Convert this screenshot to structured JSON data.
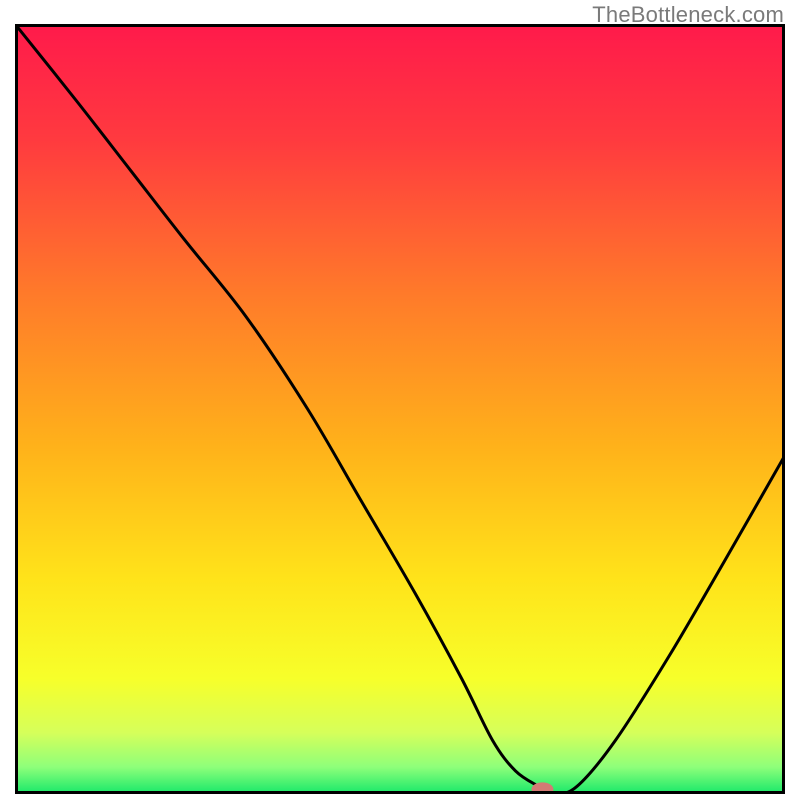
{
  "watermark": "TheBottleneck.com",
  "chart_data": {
    "type": "line",
    "title": "",
    "xlabel": "",
    "ylabel": "",
    "xlim": [
      0,
      100
    ],
    "ylim": [
      0,
      100
    ],
    "grid": false,
    "legend": false,
    "series": [
      {
        "name": "bottleneck-curve",
        "x": [
          0,
          8,
          15,
          22,
          30,
          38,
          45,
          52,
          58,
          62,
          65,
          68,
          70,
          73,
          78,
          85,
          92,
          100
        ],
        "y": [
          100,
          90,
          81,
          72,
          62,
          50,
          38,
          26,
          15,
          7,
          3,
          1,
          0,
          1,
          7,
          18,
          30,
          44
        ]
      }
    ],
    "marker": {
      "x": 68.5,
      "y": 0.6
    },
    "gradient_stops": [
      {
        "offset": 0.0,
        "color": "#ff1a4b"
      },
      {
        "offset": 0.15,
        "color": "#ff3a3f"
      },
      {
        "offset": 0.35,
        "color": "#ff7a2a"
      },
      {
        "offset": 0.55,
        "color": "#ffb21a"
      },
      {
        "offset": 0.72,
        "color": "#ffe31a"
      },
      {
        "offset": 0.85,
        "color": "#f7ff2a"
      },
      {
        "offset": 0.92,
        "color": "#d6ff5a"
      },
      {
        "offset": 0.965,
        "color": "#8eff7a"
      },
      {
        "offset": 1.0,
        "color": "#17e86a"
      }
    ],
    "curve_stroke": "#000000",
    "curve_stroke_width": 3,
    "border_stroke": "#000000",
    "border_stroke_width": 3,
    "marker_fill": "#d47a74",
    "marker_rx": 11,
    "marker_ry": 7
  }
}
